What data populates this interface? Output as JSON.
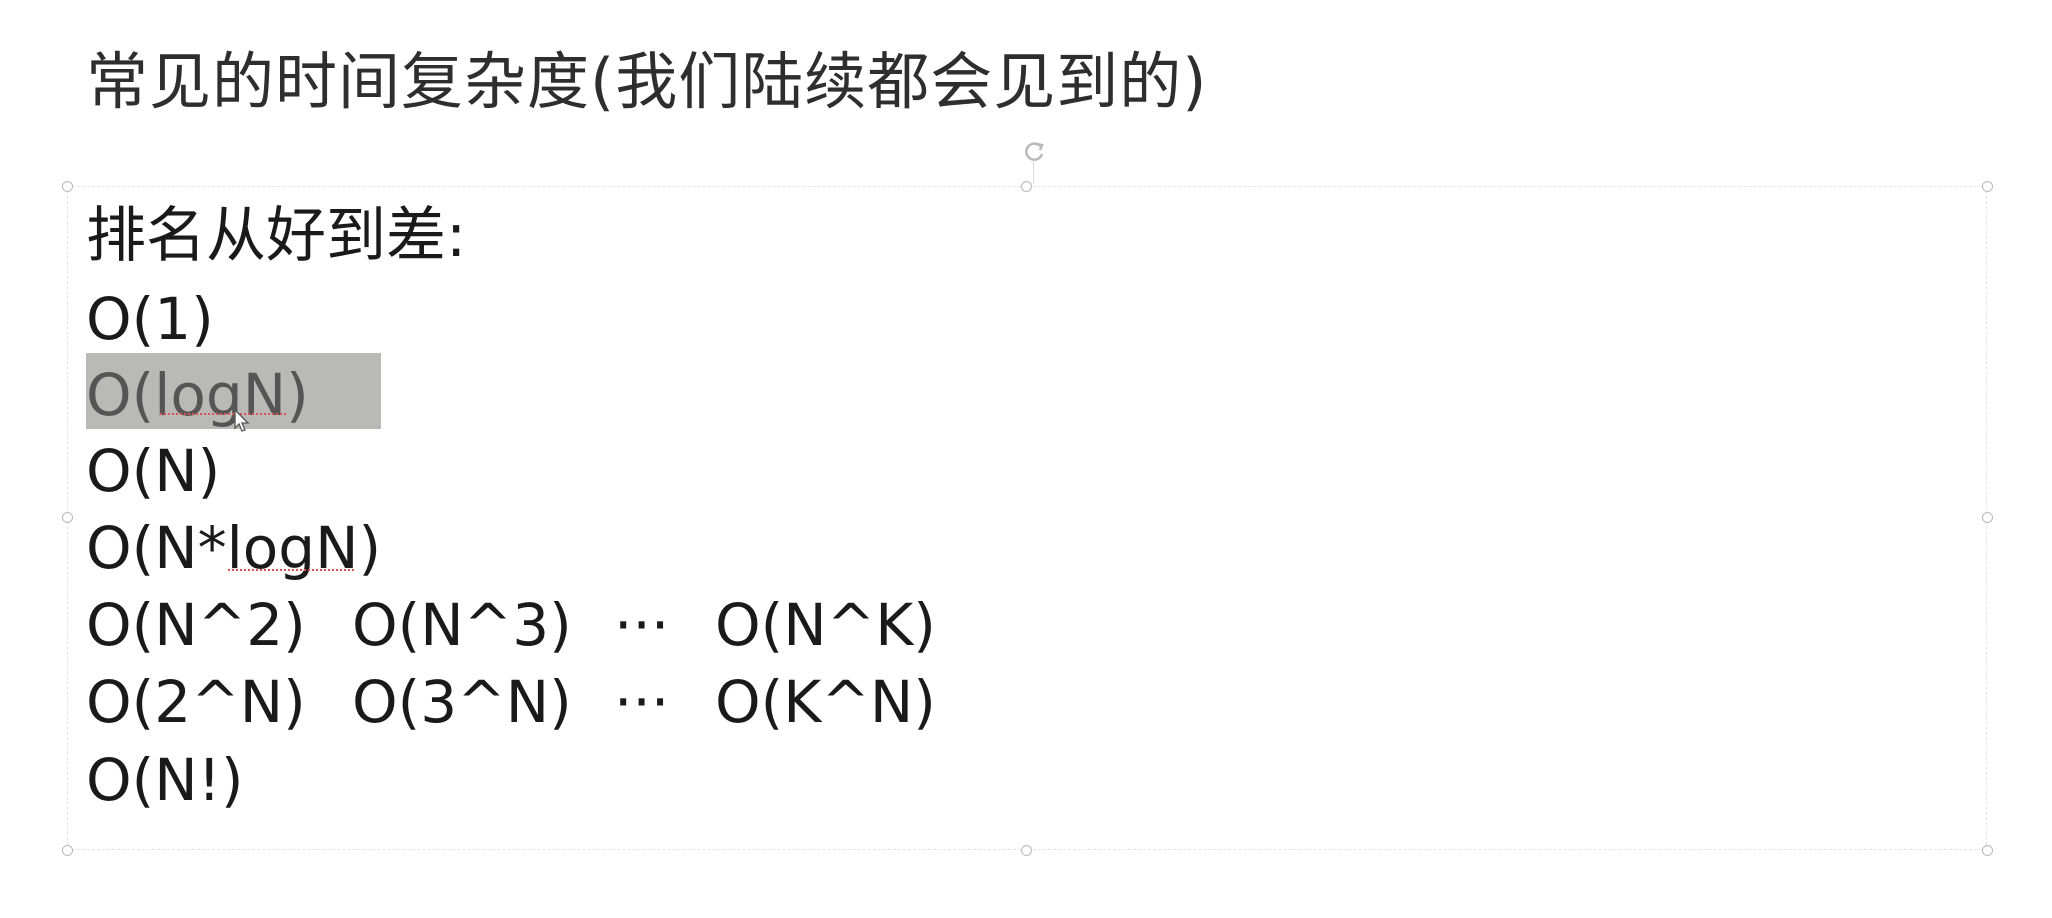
{
  "slide": {
    "title": "常见的时间复杂度(我们陆续都会见到的)",
    "heading": "排名从好到差:",
    "lines": [
      [
        "O(1)"
      ],
      [
        "O(logN)"
      ],
      [
        "O(N)"
      ],
      [
        "O(N*logN)"
      ],
      [
        "O(N^2)",
        "O(N^3)",
        "···",
        "O(N^K)"
      ],
      [
        "O(2^N)",
        "O(3^N)",
        "···",
        "O(K^N)"
      ],
      [
        "O(N!)"
      ]
    ]
  },
  "colors": {
    "selection": "#b9bab7",
    "spellcheck": "#e05050",
    "handle": "#b8b8b8"
  },
  "icons": {
    "rotate": "rotate-icon",
    "cursor": "mouse-pointer-icon"
  }
}
